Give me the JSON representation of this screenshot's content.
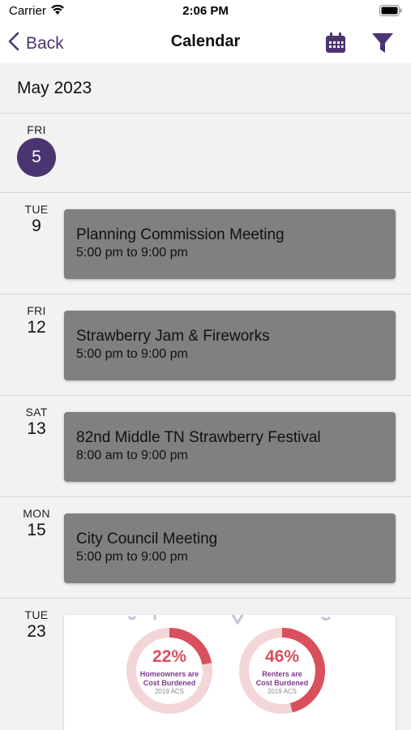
{
  "status_bar": {
    "carrier": "Carrier",
    "time": "2:06 PM"
  },
  "nav": {
    "back_label": "Back",
    "title": "Calendar"
  },
  "month": "May 2023",
  "days": [
    {
      "weekday": "FRI",
      "day": "5",
      "selected": true
    },
    {
      "weekday": "TUE",
      "day": "9",
      "event": {
        "title": "Planning Commission Meeting",
        "time": "5:00 pm to 9:00 pm"
      }
    },
    {
      "weekday": "FRI",
      "day": "12",
      "event": {
        "title": "Strawberry Jam & Fireworks",
        "time": "5:00 pm to 9:00 pm"
      }
    },
    {
      "weekday": "SAT",
      "day": "13",
      "event": {
        "title": "82nd Middle TN Strawberry Festival",
        "time": "8:00 am to 9:00 pm"
      }
    },
    {
      "weekday": "MON",
      "day": "15",
      "event": {
        "title": "City Council Meeting",
        "time": "5:00 pm to 9:00 pm"
      }
    },
    {
      "weekday": "TUE",
      "day": "23",
      "image_card": {
        "stats": [
          {
            "percent": "22%",
            "label_line1": "Homeowners are",
            "label_line2": "Cost Burdened",
            "source": "2019 ACS",
            "fraction": 0.22
          },
          {
            "percent": "46%",
            "label_line1": "Renters are",
            "label_line2": "Cost Burdened",
            "source": "2019 ACS",
            "fraction": 0.46
          }
        ]
      }
    }
  ],
  "colors": {
    "accent": "#4a3570",
    "event_card": "#808080",
    "background": "#f2f2f2",
    "donut_fill": "#d94f5c",
    "donut_track": "#f3d6d8"
  },
  "icons": {
    "back": "chevron-left-icon",
    "calendar": "calendar-icon",
    "filter": "filter-icon",
    "wifi": "wifi-icon",
    "battery": "battery-icon"
  }
}
